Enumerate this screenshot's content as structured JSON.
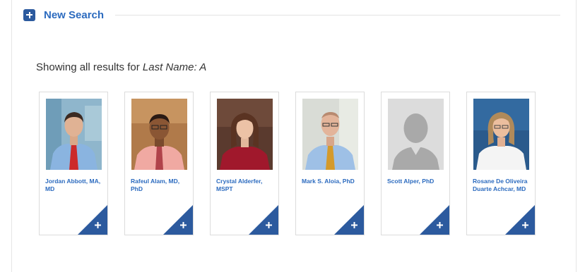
{
  "search": {
    "new_search_label": "New Search",
    "results_prefix": "Showing all results for ",
    "results_query": "Last Name: A"
  },
  "colors": {
    "accent": "#2c5a9e",
    "link": "#2c6bbf"
  },
  "providers": [
    {
      "name": "Jordan Abbott, MA, MD",
      "photo": "photo",
      "add_icon": "plus-icon"
    },
    {
      "name": "Rafeul Alam, MD, PhD",
      "photo": "photo",
      "add_icon": "plus-icon"
    },
    {
      "name": "Crystal Alderfer, MSPT",
      "photo": "photo",
      "add_icon": "plus-icon"
    },
    {
      "name": "Mark S. Aloia, PhD",
      "photo": "photo",
      "add_icon": "plus-icon"
    },
    {
      "name": "Scott Alper, PhD",
      "photo": "placeholder-avatar",
      "add_icon": "plus-icon"
    },
    {
      "name": "Rosane De Oliveira Duarte Achcar, MD",
      "photo": "photo",
      "add_icon": "plus-icon"
    }
  ]
}
